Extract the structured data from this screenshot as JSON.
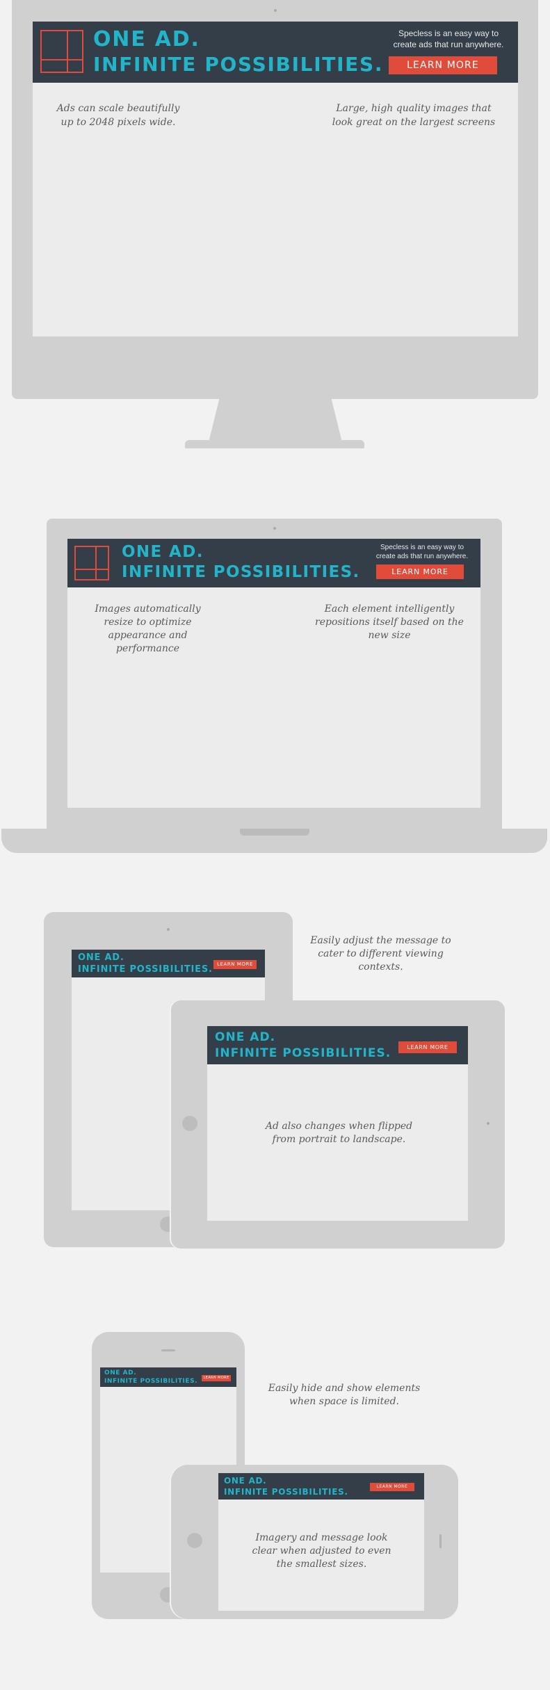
{
  "ad": {
    "title_line1": "ONE AD.",
    "title_line2": "INFINITE POSSIBILITIES.",
    "tagline_line1": "Specless is an easy way to",
    "tagline_line2": "create ads that run anywhere.",
    "button_label": "LEARN MORE",
    "colors": {
      "accent": "#22b5c9",
      "button": "#e14b3a",
      "banner": "#343e48",
      "device": "#d0d0d0",
      "background": "#f2f2f2"
    }
  },
  "desktop": {
    "note_left": "Ads can scale beautifully up to 2048 pixels wide.",
    "note_right": "Large, high quality images that look great on the largest screens"
  },
  "laptop": {
    "note_left": "Images automatically resize to optimize appearance and performance",
    "note_right": "Each element intelligently repositions itself based on the new size"
  },
  "tablet": {
    "note_top": "Easily adjust the message to cater to different viewing contexts.",
    "note_center": "Ad also changes when flipped from portrait to landscape."
  },
  "phone": {
    "note_top": "Easily hide and show elements when space is limited.",
    "note_center": "Imagery and message look clear when adjusted to even the smallest sizes."
  }
}
